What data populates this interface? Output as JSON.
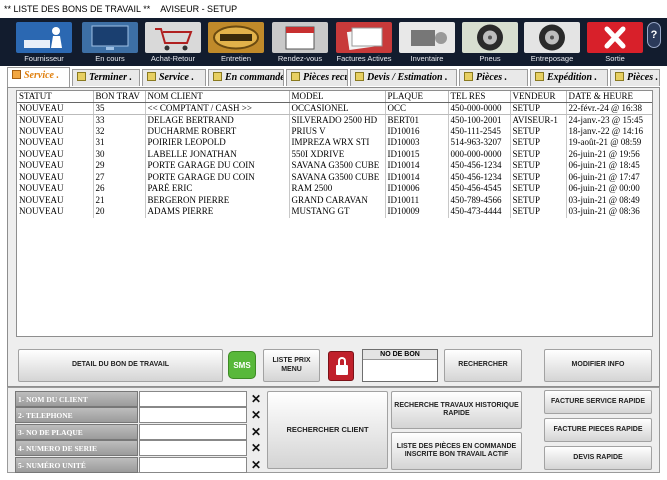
{
  "title_bar": {
    "app": "** LISTE DES BONS DE TRAVAIL **",
    "module": "AVISEUR - SETUP"
  },
  "toolbar": [
    {
      "label": "Fournisseur",
      "icon": "person-desk-icon",
      "color": "#2b68b2"
    },
    {
      "label": "En cours",
      "icon": "monitor-icon",
      "color": "#3d6fa5"
    },
    {
      "label": "Achat-Retour",
      "icon": "shopping-cart-icon",
      "color": "#d9d9d9"
    },
    {
      "label": "Entretien",
      "icon": "service-badge-icon",
      "color": "#c08a2a"
    },
    {
      "label": "Rendez-vous",
      "icon": "calendar-icon",
      "color": "#c9c9c9"
    },
    {
      "label": "Factures Actives",
      "icon": "invoice-stack-icon",
      "color": "#c83a3a"
    },
    {
      "label": "Inventaire",
      "icon": "engine-parts-icon",
      "color": "#e8e8e8"
    },
    {
      "label": "Pneus",
      "icon": "tire-icon",
      "color": "#d8dfd0"
    },
    {
      "label": "Entreposage",
      "icon": "wheel-rim-icon",
      "color": "#e4e4e4"
    },
    {
      "label": "Sortie",
      "icon": "close-icon",
      "color": "#d8202a"
    }
  ],
  "help_label": "?",
  "tabs": [
    {
      "label": "Service .",
      "active": true
    },
    {
      "label": "Terminer .",
      "active": false
    },
    {
      "label": "Service .",
      "active": false
    },
    {
      "label": "En commande .",
      "active": false
    },
    {
      "label": "Pièces recu .",
      "active": false
    },
    {
      "label": "Devis / Estimation .",
      "active": false
    },
    {
      "label": "Pièces .",
      "active": false
    },
    {
      "label": "Expédition .",
      "active": false
    },
    {
      "label": "Pièces .",
      "active": false
    }
  ],
  "grid": {
    "columns": [
      "STATUT",
      "BON TRAV",
      "NOM CLIENT",
      "MODEL",
      "PLAQUE",
      "TEL RES",
      "VENDEUR",
      "DATE & HEURE"
    ],
    "rows": [
      [
        "NOUVEAU",
        "35",
        "<< COMPTANT / CASH >>",
        "OCCASIONEL",
        "OCC",
        "450-000-0000",
        "SETUP",
        "22-févr.-24 @ 16:38"
      ],
      [
        "NOUVEAU",
        "33",
        "DELAGE BERTRAND",
        "SILVERADO 2500 HD",
        "BERT01",
        "450-100-2001",
        "AVISEUR-1",
        "24-janv.-23 @ 15:45"
      ],
      [
        "NOUVEAU",
        "32",
        "DUCHARME ROBERT",
        "PRIUS V",
        "ID10016",
        "450-111-2545",
        "SETUP",
        "18-janv.-22 @ 14:16"
      ],
      [
        "NOUVEAU",
        "31",
        "POIRIER LEOPOLD",
        "IMPREZA WRX STI",
        "ID10003",
        "514-963-3207",
        "SETUP",
        "19-août-21 @ 08:59"
      ],
      [
        "NOUVEAU",
        "30",
        "LABELLE JONATHAN",
        "550I XDRIVE",
        "ID10015",
        "000-000-0000",
        "SETUP",
        "26-juin-21 @ 19:56"
      ],
      [
        "NOUVEAU",
        "29",
        "PORTE GARAGE DU COIN",
        "SAVANA G3500 CUBE",
        "ID10014",
        "450-456-1234",
        "SETUP",
        "06-juin-21 @ 18:45"
      ],
      [
        "NOUVEAU",
        "27",
        "PORTE GARAGE DU COIN",
        "SAVANA G3500 CUBE",
        "ID10014",
        "450-456-1234",
        "SETUP",
        "06-juin-21 @ 17:47"
      ],
      [
        "NOUVEAU",
        "26",
        "PARÉ ERIC",
        "RAM 2500",
        "ID10006",
        "450-456-4545",
        "SETUP",
        "06-juin-21 @ 00:00"
      ],
      [
        "NOUVEAU",
        "21",
        "BERGERON PIERRE",
        "GRAND CARAVAN",
        "ID10011",
        "450-789-4566",
        "SETUP",
        "03-juin-21 @ 08:49"
      ],
      [
        "NOUVEAU",
        "20",
        "ADAMS PIERRE",
        "MUSTANG GT",
        "ID10009",
        "450-473-4444",
        "SETUP",
        "03-juin-21 @ 08:36"
      ]
    ]
  },
  "buttons": {
    "detail": "DETAIL DU BON DE TRAVAIL",
    "sms": "SMS",
    "price_list": "LISTE PRIX MENU",
    "no_bon_label": "NO DE BON",
    "search": "RECHERCHER",
    "modify": "MODIFIER INFO"
  },
  "search": {
    "fields": [
      {
        "label": "1- NOM DU CLIENT",
        "value": ""
      },
      {
        "label": "2- TELEPHONE",
        "value": ""
      },
      {
        "label": "3- NO DE PLAQUE",
        "value": ""
      },
      {
        "label": "4- NUMERO DE SERIE",
        "value": ""
      },
      {
        "label": "5- NUMÉRO UNITÉ",
        "value": ""
      }
    ],
    "clear_glyph": "✕",
    "client_search_button": "RECHERCHER CLIENT",
    "history_button": "RECHERCHE TRAVAUX HISTORIQUE RAPIDE",
    "parts_order_button": "LISTE DES PIÈCES EN COMMANDE INSCRITE BON TRAVAIL ACTIF",
    "quick_service_invoice": "FACTURE SERVICE RAPIDE",
    "quick_parts_invoice": "FACTURE PIECES RAPIDE",
    "quick_quote": "DEVIS  RAPIDE"
  }
}
